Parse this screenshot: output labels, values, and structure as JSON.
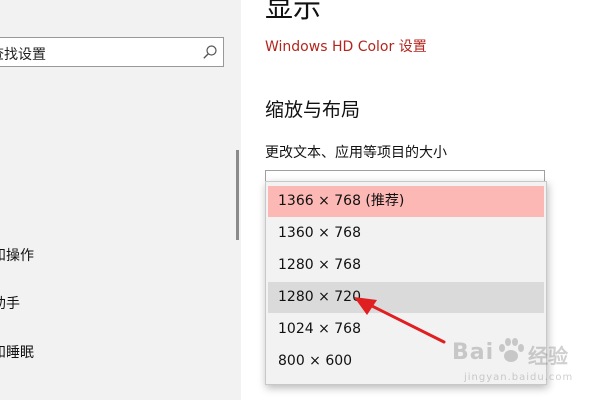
{
  "nav": {
    "search_text": "查找设置",
    "items": [
      {
        "label": "和操作"
      },
      {
        "label": "助手"
      },
      {
        "label": "和睡眠"
      }
    ]
  },
  "main": {
    "title": "显示",
    "hdr_link": "Windows HD Color 设置",
    "section_title": "缩放与布局",
    "field_label": "更改文本、应用等项目的大小"
  },
  "dropdown": {
    "options": [
      {
        "label": "1366 × 768 (推荐)",
        "state": "selected"
      },
      {
        "label": "1360 × 768",
        "state": "normal"
      },
      {
        "label": "1280 × 768",
        "state": "normal"
      },
      {
        "label": "1280 × 720",
        "state": "hovered"
      },
      {
        "label": "1024 × 768",
        "state": "normal"
      },
      {
        "label": "800 × 600",
        "state": "normal"
      }
    ]
  },
  "annotation": {
    "arrow_color": "#e02020"
  },
  "watermark": {
    "brand_left": "Bai",
    "brand_right": "经验",
    "url": "jingyan.baidu.com"
  },
  "colors": {
    "link": "#b3261e",
    "selected_option": "#fbb8b4",
    "hovered_option": "#dadada",
    "nav_background": "#f2f2f2"
  }
}
